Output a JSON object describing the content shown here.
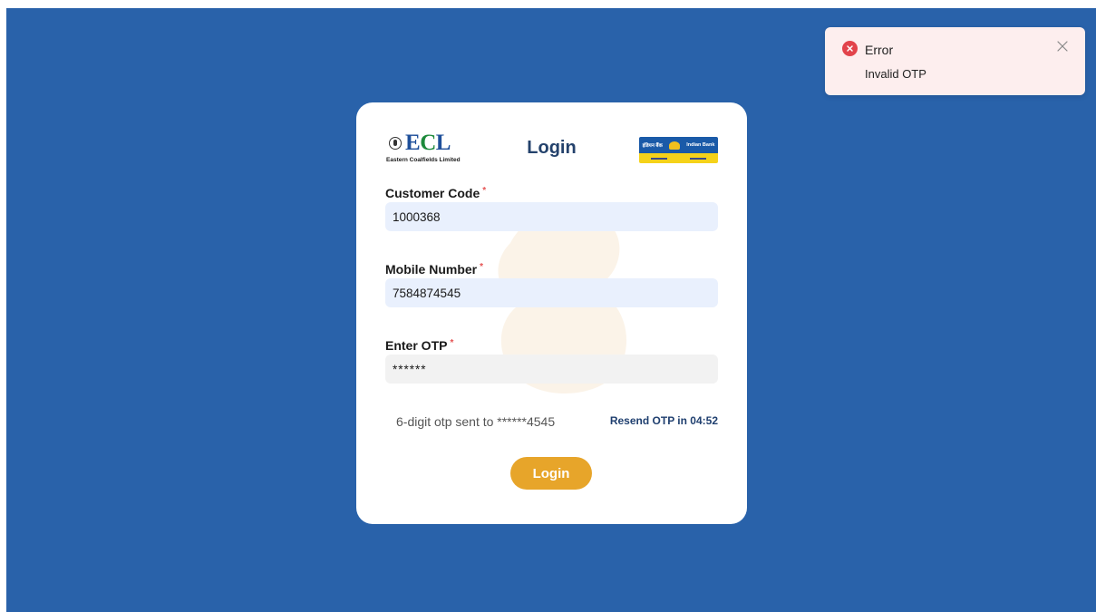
{
  "toast": {
    "title": "Error",
    "message": "Invalid OTP",
    "icon": "error-circle-icon",
    "close_icon": "close-icon",
    "accent_color": "#e2434b"
  },
  "card": {
    "title": "Login",
    "ecl_logo": {
      "text_prefix": "E",
      "text_c": "C",
      "text_suffix": "L",
      "subtitle": "Eastern Coalfields Limited"
    },
    "bank_logo": {
      "hindi_text": "इंडियन बैंक",
      "english_text": "Indian Bank"
    },
    "customer_code": {
      "label": "Customer Code",
      "required_mark": "*",
      "value": "1000368"
    },
    "mobile_number": {
      "label": "Mobile Number",
      "required_mark": "*",
      "value": "7584874545"
    },
    "otp": {
      "label": "Enter OTP",
      "required_mark": "*",
      "value": "******"
    },
    "otp_note": "6-digit otp sent to ******4545",
    "resend_text": "Resend OTP in 04:52",
    "login_button": "Login"
  },
  "colors": {
    "background": "#2962aa",
    "button": "#e7a52a",
    "title": "#24426c"
  }
}
